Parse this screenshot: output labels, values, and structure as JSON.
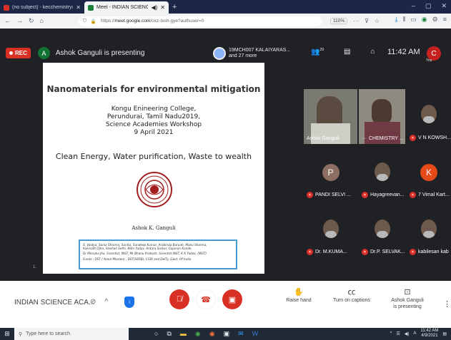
{
  "browser": {
    "tabs": [
      {
        "label": "(no subject) - kecchemistry@i",
        "active": false,
        "icon_color": "#d93025"
      },
      {
        "label": "Meet - INDIAN SCIENCE AC",
        "active": true,
        "icon_color": "#188038"
      }
    ],
    "new_tab": "+",
    "url_prefix": "https://",
    "url_host": "meet.google.com",
    "url_path": "/oxz-txsh-gye?authuser=0",
    "zoom": "110%"
  },
  "meeting": {
    "rec_label": "REC",
    "presenter_initial": "A",
    "presenting_text": "Ashok Ganguli is presenting",
    "speaker_line1": "19MCH007 KALAIYARAS...",
    "speaker_line2": "and 27 more",
    "participant_count": "29",
    "time": "11:42 AM",
    "user_initial": "C",
    "user_label": "You"
  },
  "slide": {
    "title": "Nanomaterials for environmental mitigation",
    "lines": [
      "Kongu Enineering College,",
      "Perundurai, Tamil Nadu2019,",
      "Science Academies Workshop",
      "9 April 2021"
    ],
    "tagline": "Clean Energy, Water purification, Waste to wealth",
    "author": "Ashok K. Ganguli",
    "credits": [
      "S. Vaidya, Sonia Sharma, Sunita, Sandeep Kumar, Arabinda Baruah, Manu Sharma,",
      "Kasinath Ojha, Vaishali Sethi, Nitin Yadav, Antara Sarkar, Gajanan Kunde,",
      "Dr Menaka Jha, Scientist, INST, Mr Bhanu Prakash, Scientist INST, K K Yadav, (INST)",
      "Funds : DST ( Nano Mission) , DST(SERB), CSIR and DeiTy, Govt. Of India"
    ],
    "page_marker": "1."
  },
  "participants": [
    {
      "name": "Ashok Ganguli",
      "kind": "video",
      "muted": false
    },
    {
      "name": "CHEMISTRY ...",
      "kind": "video",
      "muted": false
    },
    {
      "name": "V N KOWSH...",
      "kind": "photo",
      "muted": true
    },
    {
      "name": "PANDI SELVI ...",
      "kind": "letter",
      "letter": "P",
      "color": "#8d6e63",
      "muted": true
    },
    {
      "name": "Hayagreevan...",
      "kind": "photo",
      "muted": true
    },
    {
      "name": "7 Vimal Kart...",
      "kind": "letter",
      "letter": "K",
      "color": "#e64a19",
      "muted": true
    },
    {
      "name": "Dr. M.KUMA...",
      "kind": "photo",
      "muted": true
    },
    {
      "name": "Dr.P. SELVAK...",
      "kind": "photo",
      "muted": true
    },
    {
      "name": "kabilesan kab",
      "kind": "photo",
      "muted": true
    }
  ],
  "toolbar": {
    "meeting_name": "INDIAN SCIENCE ACA...",
    "raise_hand": "Raise hand",
    "captions": "Turn on captions",
    "presenting_line1": "Ashok Ganguli",
    "presenting_line2": "is presenting"
  },
  "taskbar": {
    "search_placeholder": "Type here to search",
    "time": "11:42 AM",
    "date": "4/9/2021"
  },
  "colors": {
    "meet_bg": "#202124",
    "end_call": "#d93025",
    "accent_blue": "#1a73e8"
  }
}
